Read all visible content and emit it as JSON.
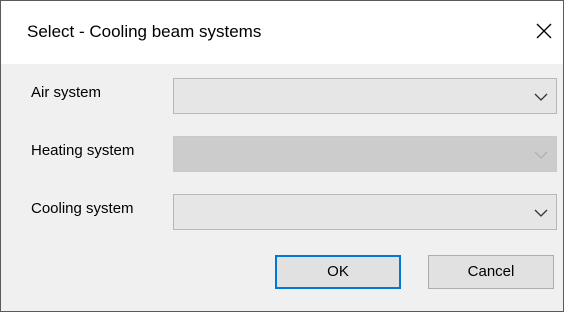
{
  "window": {
    "title": "Select - Cooling beam systems",
    "close_icon": "close-icon"
  },
  "fields": [
    {
      "label": "Air system",
      "value": "",
      "enabled": true,
      "icon": "chevron-down-icon"
    },
    {
      "label": "Heating system",
      "value": "",
      "enabled": false,
      "icon": "chevron-down-icon"
    },
    {
      "label": "Cooling system",
      "value": "",
      "enabled": true,
      "icon": "chevron-down-icon"
    }
  ],
  "buttons": {
    "ok_label": "OK",
    "cancel_label": "Cancel"
  },
  "colors": {
    "title_bar": "#ffffff",
    "dialog_body": "#f0f0f0",
    "default_button_border": "#0078d7",
    "disabled_combo": "#cccccc",
    "enabled_combo": "#e6e6e6"
  }
}
